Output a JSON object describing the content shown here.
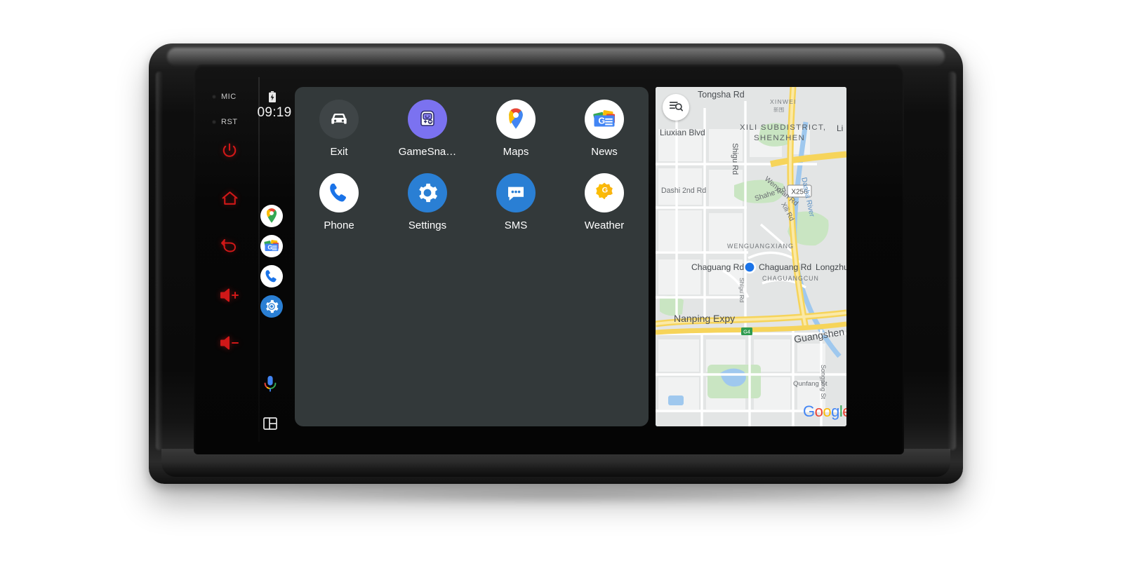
{
  "device": {
    "name": "car-head-unit",
    "indicators": [
      {
        "id": "mic",
        "label": "MIC"
      },
      {
        "id": "rst",
        "label": "RST"
      }
    ],
    "hardware_keys": [
      {
        "id": "power",
        "icon": "power-icon"
      },
      {
        "id": "home",
        "icon": "home-icon"
      },
      {
        "id": "back",
        "icon": "back-arrow-icon"
      },
      {
        "id": "volume-up",
        "icon": "volume-up-icon"
      },
      {
        "id": "volume-down",
        "icon": "volume-down-icon"
      }
    ],
    "key_color": "#d01818"
  },
  "statusbar": {
    "time": "09:19",
    "battery_icon": "battery-charging-icon"
  },
  "rail": {
    "apps": [
      {
        "name": "maps",
        "icon": "maps-icon"
      },
      {
        "name": "news",
        "icon": "news-icon"
      },
      {
        "name": "phone",
        "icon": "phone-icon"
      },
      {
        "name": "settings",
        "icon": "settings-gear-icon",
        "active": true
      }
    ],
    "assistant_icon": "google-assistant-mic-icon",
    "apps_grid_icon": "split-screen-icon"
  },
  "launcher": {
    "apps": [
      {
        "label": "Exit",
        "icon": "car-icon",
        "style": "exit"
      },
      {
        "label": "GameSna…",
        "icon": "gamesnacks-icon",
        "style": "purple"
      },
      {
        "label": "Maps",
        "icon": "maps-icon",
        "style": "white"
      },
      {
        "label": "News",
        "icon": "news-icon",
        "style": "white"
      },
      {
        "label": "Phone",
        "icon": "phone-icon",
        "style": "white"
      },
      {
        "label": "Settings",
        "icon": "settings-gear-icon",
        "style": "blue"
      },
      {
        "label": "SMS",
        "icon": "sms-bubble-icon",
        "style": "blue"
      },
      {
        "label": "Weather",
        "icon": "weather-sun-icon",
        "style": "white"
      }
    ]
  },
  "map": {
    "search_icon": "search-list-icon",
    "watermark": "Google",
    "watermark_colors": [
      "#4285F4",
      "#EA4335",
      "#FBBC05",
      "#4285F4",
      "#34A853",
      "#EA4335"
    ],
    "road_shield": "X256",
    "highway_shield": "G4",
    "labels": [
      "Tongsha Rd",
      "XINWEI",
      "新围",
      "Liuxian Blvd",
      "XILI SUBDISTRICT,",
      "SHENZHEN",
      "Li",
      "Shigu Rd",
      "Dashi 2nd Rd",
      "Shahe Rd",
      "Wenyuan Rd",
      "Xili Rd",
      "Dasha River",
      "WENGUANGXIANG",
      "Chaguang Rd",
      "Chaguang Rd",
      "CHAGUANGCUN",
      "Longzhu",
      "Shigu Rd",
      "Nanping Expy",
      "Guangshen",
      "Qunfang St",
      "Songping St"
    ],
    "current_location_color": "#1a73e8"
  }
}
